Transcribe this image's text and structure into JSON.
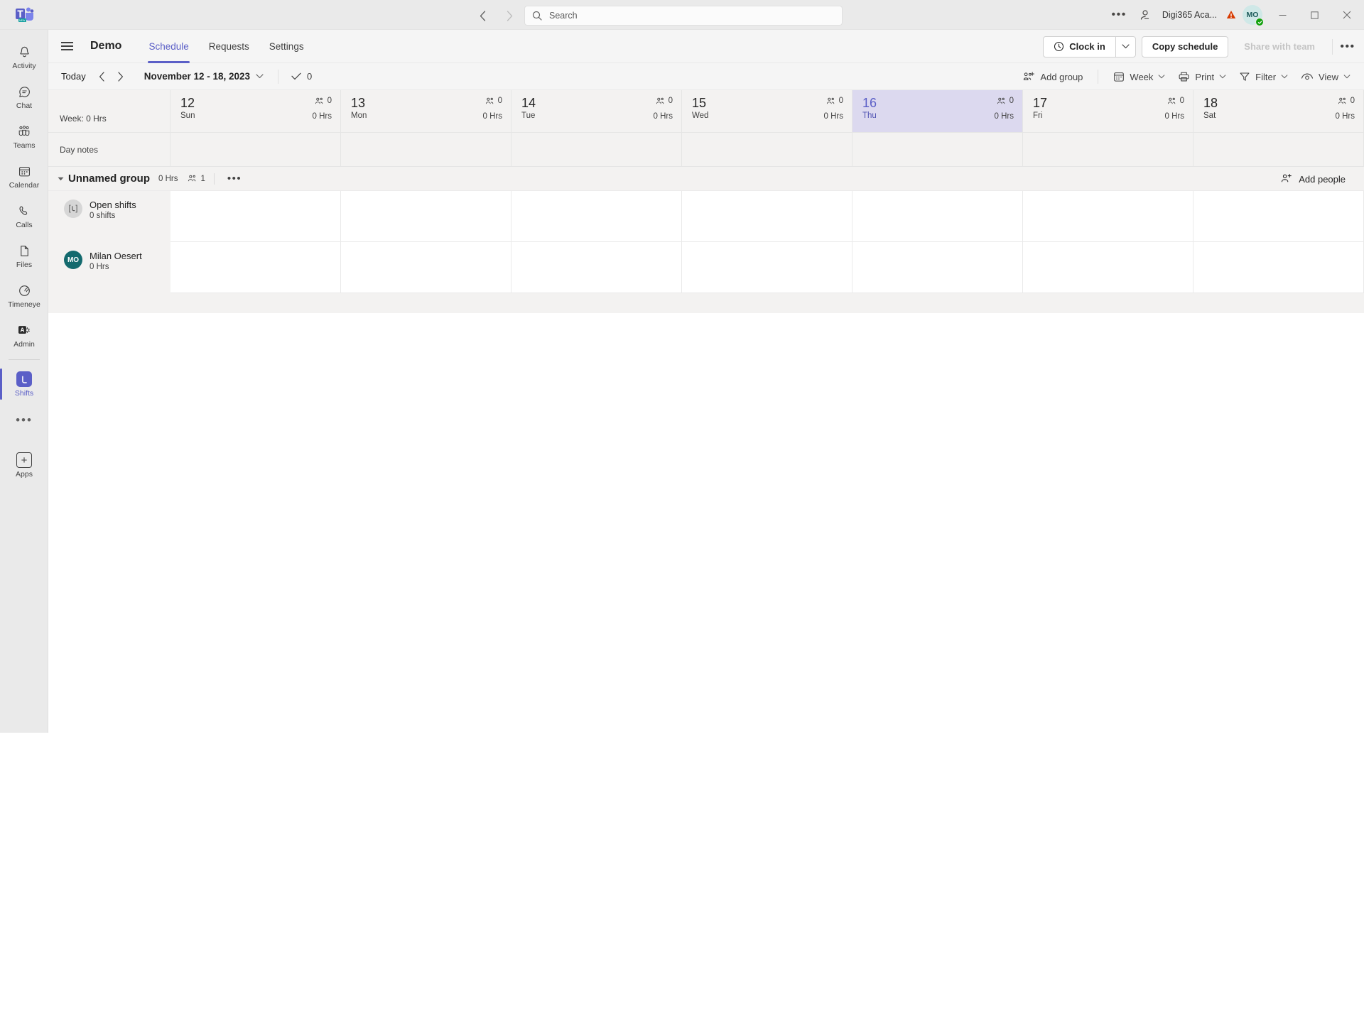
{
  "titlebar": {
    "logo_icon": "teams-logo-icon",
    "back_icon": "chevron-left-icon",
    "forward_icon": "chevron-right-icon",
    "search": {
      "placeholder": "Search",
      "value": "",
      "icon": "search-icon"
    },
    "more_label": "•••",
    "people_icon": "person-add-icon",
    "tenant": "Digi365 Aca...",
    "warning_icon": "warning-triangle-icon",
    "avatar": {
      "initials": "MO",
      "presence": "available",
      "presence_color": "#13a10e"
    },
    "window": {
      "minimize": "—",
      "maximize": "□",
      "close": "✕"
    }
  },
  "rail": {
    "items": [
      {
        "label": "Activity",
        "icon": "bell-icon",
        "active": false
      },
      {
        "label": "Chat",
        "icon": "chat-bubble-icon",
        "active": false
      },
      {
        "label": "Teams",
        "icon": "teams-people-icon",
        "active": false
      },
      {
        "label": "Calendar",
        "icon": "calendar-icon",
        "active": false
      },
      {
        "label": "Calls",
        "icon": "phone-icon",
        "active": false
      },
      {
        "label": "Files",
        "icon": "file-icon",
        "active": false
      },
      {
        "label": "Timeneye",
        "icon": "timeneye-icon",
        "active": false
      },
      {
        "label": "Admin",
        "icon": "admin-gear-icon",
        "active": false
      },
      {
        "label": "Shifts",
        "icon": "shifts-icon",
        "active": true
      }
    ],
    "more_label": "•••",
    "apps": {
      "label": "Apps",
      "icon": "plus-box-icon"
    }
  },
  "header": {
    "menu_icon": "hamburger-menu-icon",
    "title": "Demo",
    "tabs": [
      {
        "label": "Schedule",
        "active": true
      },
      {
        "label": "Requests",
        "active": false
      },
      {
        "label": "Settings",
        "active": false
      }
    ],
    "clock_in": {
      "label": "Clock in",
      "icon": "clock-icon",
      "caret": "chevron-down-icon"
    },
    "copy_schedule": "Copy schedule",
    "share_with_team": "Share with team",
    "more_label": "•••"
  },
  "toolbar": {
    "today": "Today",
    "prev_icon": "chevron-left-icon",
    "next_icon": "chevron-right-icon",
    "date_range": "November 12 - 18, 2023",
    "date_caret": "chevron-down-icon",
    "checked_count": "0",
    "check_icon": "checkmark-icon",
    "add_group": {
      "label": "Add group",
      "icon": "add-group-icon"
    },
    "view_mode": {
      "label": "Week",
      "icon": "calendar-icon",
      "caret": "chevron-down-icon"
    },
    "print": {
      "label": "Print",
      "icon": "printer-icon",
      "caret": "chevron-down-icon"
    },
    "filter": {
      "label": "Filter",
      "icon": "filter-funnel-icon",
      "caret": "chevron-down-icon"
    },
    "view": {
      "label": "View",
      "icon": "eye-icon",
      "caret": "chevron-down-icon"
    }
  },
  "grid": {
    "week_total_label": "Week: 0 Hrs",
    "day_notes_label": "Day notes",
    "days": [
      {
        "num": "12",
        "dow": "Sun",
        "people": "0",
        "hours": "0 Hrs",
        "today": false
      },
      {
        "num": "13",
        "dow": "Mon",
        "people": "0",
        "hours": "0 Hrs",
        "today": false
      },
      {
        "num": "14",
        "dow": "Tue",
        "people": "0",
        "hours": "0 Hrs",
        "today": false
      },
      {
        "num": "15",
        "dow": "Wed",
        "people": "0",
        "hours": "0 Hrs",
        "today": false
      },
      {
        "num": "16",
        "dow": "Thu",
        "people": "0",
        "hours": "0 Hrs",
        "today": true
      },
      {
        "num": "17",
        "dow": "Fri",
        "people": "0",
        "hours": "0 Hrs",
        "today": false
      },
      {
        "num": "18",
        "dow": "Sat",
        "people": "0",
        "hours": "0 Hrs",
        "today": false
      }
    ],
    "group": {
      "name": "Unnamed group",
      "hours": "0 Hrs",
      "people_count": "1",
      "people_icon": "people-icon",
      "collapse_icon": "caret-down-icon",
      "more_label": "•••",
      "add_people": {
        "label": "Add people",
        "icon": "person-add-icon"
      }
    },
    "rows": [
      {
        "name": "Open shifts",
        "sub": "0 shifts",
        "avatar_type": "open-shifts-icon",
        "initials": ""
      },
      {
        "name": "Milan Oesert",
        "sub": "0 Hrs",
        "avatar_type": "initials",
        "initials": "MO"
      }
    ]
  },
  "colors": {
    "accent": "#5b5fc7",
    "today_bg": "#dcd9ef",
    "rail_bg": "#eaeaea",
    "grid_bg": "#f3f2f1",
    "avatar_teal": "#136a6e",
    "presence_green": "#13a10e",
    "warning_orange": "#d83b01"
  }
}
